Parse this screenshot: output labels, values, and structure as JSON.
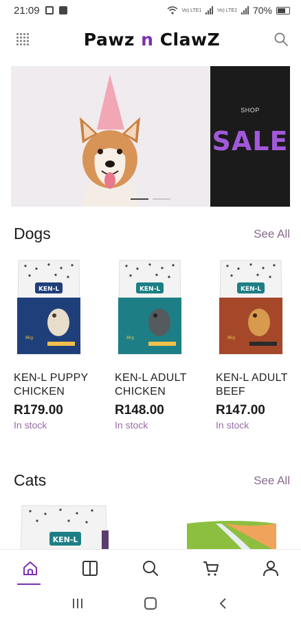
{
  "status_bar": {
    "time": "21:09",
    "net1": "Vo) LTE1",
    "net2": "Vo) LTE2",
    "battery": "70%"
  },
  "header": {
    "brand_part1": "Pawz ",
    "brand_part2": "n",
    "brand_part3": " ClawZ"
  },
  "banner": {
    "shop": "SHOP",
    "sale": "SALE",
    "slides": 2,
    "active_slide": 1
  },
  "dogs": {
    "title": "Dogs",
    "see_all": "See All",
    "products": [
      {
        "name_line1": "KEN-L PUPPY",
        "name_line2": "CHICKEN",
        "price": "R179.00",
        "stock": "In stock",
        "bag_color": "#1f3f7a"
      },
      {
        "name_line1": "KEN-L ADULT",
        "name_line2": "CHICKEN",
        "price": "R148.00",
        "stock": "In stock",
        "bag_color": "#1d7f85"
      },
      {
        "name_line1": "KEN-L ADULT",
        "name_line2": "BEEF",
        "price": "R147.00",
        "stock": "In stock",
        "bag_color": "#a5482a"
      }
    ]
  },
  "cats": {
    "title": "Cats",
    "see_all": "See All"
  },
  "colors": {
    "accent": "#7b2fb5",
    "sale": "#a259d9",
    "stock": "#9a6aa5"
  }
}
